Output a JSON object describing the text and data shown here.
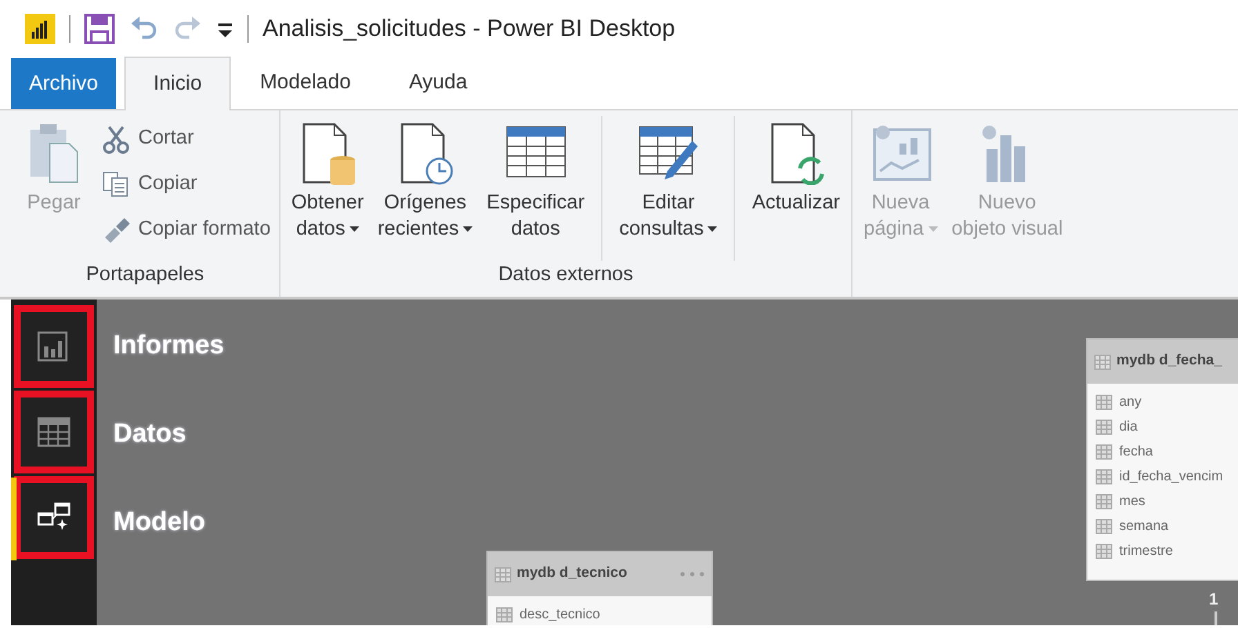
{
  "window": {
    "title": "Analisis_solicitudes - Power BI Desktop"
  },
  "tabs": [
    {
      "label": "Archivo",
      "kind": "file",
      "selected": false
    },
    {
      "label": "Inicio",
      "kind": "tab",
      "selected": true
    },
    {
      "label": "Modelado",
      "kind": "tab",
      "selected": false
    },
    {
      "label": "Ayuda",
      "kind": "tab",
      "selected": false
    }
  ],
  "ribbon": {
    "groups": [
      {
        "label": "Portapapeles",
        "items": [
          {
            "kind": "large",
            "lines": [
              "Pegar"
            ],
            "dropdown": false,
            "disabled": true
          },
          {
            "kind": "small",
            "lines": [
              "Cortar"
            ],
            "disabled": false
          },
          {
            "kind": "small",
            "lines": [
              "Copiar"
            ],
            "disabled": false
          },
          {
            "kind": "small",
            "lines": [
              "Copiar formato"
            ],
            "disabled": false
          }
        ]
      },
      {
        "label": "Datos externos",
        "items": [
          {
            "kind": "large",
            "lines": [
              "Obtener",
              "datos"
            ],
            "dropdown": true,
            "disabled": false
          },
          {
            "kind": "large",
            "lines": [
              "Orígenes",
              "recientes"
            ],
            "dropdown": true,
            "disabled": false
          },
          {
            "kind": "large",
            "lines": [
              "Especificar",
              "datos"
            ],
            "dropdown": false,
            "disabled": false
          },
          {
            "kind": "large",
            "lines": [
              "Editar",
              "consultas"
            ],
            "dropdown": true,
            "disabled": false,
            "separated": true
          },
          {
            "kind": "large",
            "lines": [
              "Actualizar"
            ],
            "dropdown": false,
            "disabled": false,
            "separated": true
          }
        ]
      },
      {
        "items": [
          {
            "kind": "large",
            "lines": [
              "Nueva",
              "página"
            ],
            "dropdown": true,
            "disabled": true
          },
          {
            "kind": "large",
            "lines": [
              "Nuevo",
              "objeto visual"
            ],
            "dropdown": false,
            "disabled": true
          }
        ]
      }
    ]
  },
  "views": [
    {
      "label": "Informes",
      "selected": false
    },
    {
      "label": "Datos",
      "selected": false
    },
    {
      "label": "Modelo",
      "selected": true
    }
  ],
  "canvas": {
    "tables": [
      {
        "title": "mydb d_fecha_",
        "fields": [
          "any",
          "dia",
          "fecha",
          "id_fecha_vencim",
          "mes",
          "semana",
          "trimestre"
        ]
      },
      {
        "title": "mydb d_tecnico",
        "fields": [
          "desc_tecnico"
        ]
      }
    ],
    "relationship": {
      "cardinality": "1"
    }
  }
}
